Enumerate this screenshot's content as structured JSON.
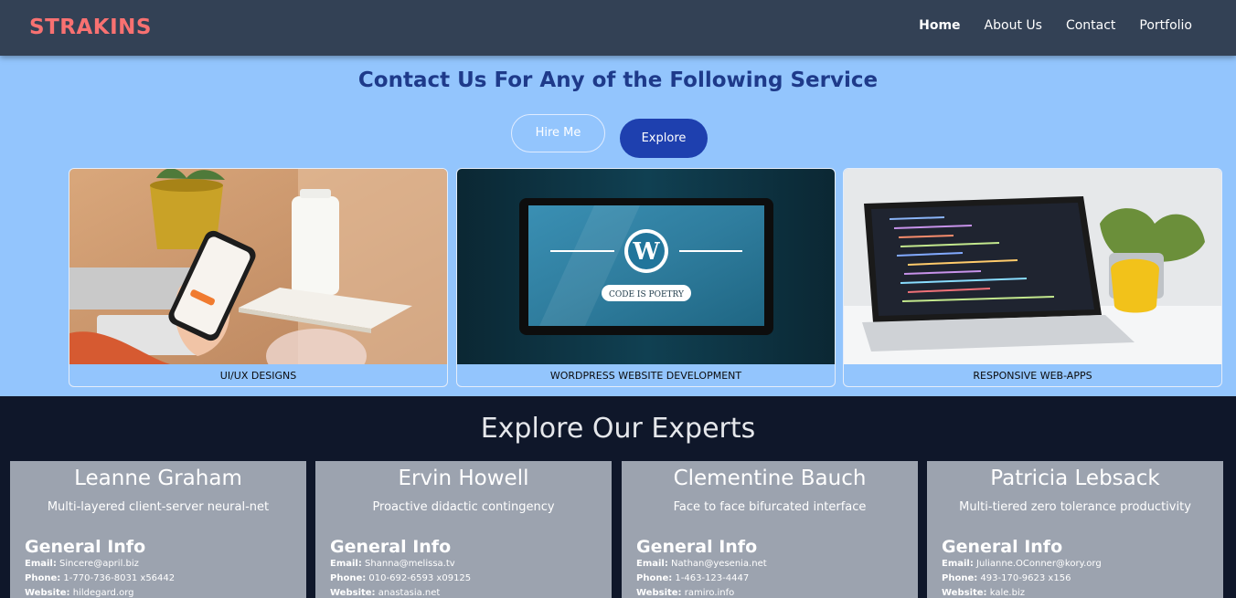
{
  "header": {
    "logo": "STRAKINS",
    "nav": [
      "Home",
      "About Us",
      "Contact",
      "Portfolio"
    ]
  },
  "hero": {
    "title": "Contact Us For Any of the Following Service",
    "hire_label": "Hire Me",
    "explore_label": "Explore",
    "cards": [
      {
        "caption": "UI/UX DESIGNS"
      },
      {
        "caption": "WORDPRESS WEBSITE DEVELOPMENT"
      },
      {
        "caption": "RESPONSIVE WEB-APPS"
      }
    ],
    "wp_badge": "CODE IS POETRY"
  },
  "experts": {
    "title": "Explore Our Experts",
    "section_heading": "General Info",
    "email_label": "Email:",
    "phone_label": "Phone:",
    "website_label": "Website:",
    "people": [
      {
        "name": "Leanne Graham",
        "tagline": "Multi-layered client-server neural-net",
        "email": "Sincere@april.biz",
        "phone": "1-770-736-8031 x56442",
        "website": "hildegard.org"
      },
      {
        "name": "Ervin Howell",
        "tagline": "Proactive didactic contingency",
        "email": "Shanna@melissa.tv",
        "phone": "010-692-6593 x09125",
        "website": "anastasia.net"
      },
      {
        "name": "Clementine Bauch",
        "tagline": "Face to face bifurcated interface",
        "email": "Nathan@yesenia.net",
        "phone": "1-463-123-4447",
        "website": "ramiro.info"
      },
      {
        "name": "Patricia Lebsack",
        "tagline": "Multi-tiered zero tolerance productivity",
        "email": "Julianne.OConner@kory.org",
        "phone": "493-170-9623 x156",
        "website": "kale.biz"
      }
    ]
  },
  "colors": {
    "header_bg": "#334155",
    "logo": "#f87171",
    "hero_bg": "#93c5fd",
    "hero_title": "#1e3a8a",
    "explore_btn": "#1e40af",
    "experts_bg": "#0f172a",
    "expert_card": "#9ca3af"
  }
}
